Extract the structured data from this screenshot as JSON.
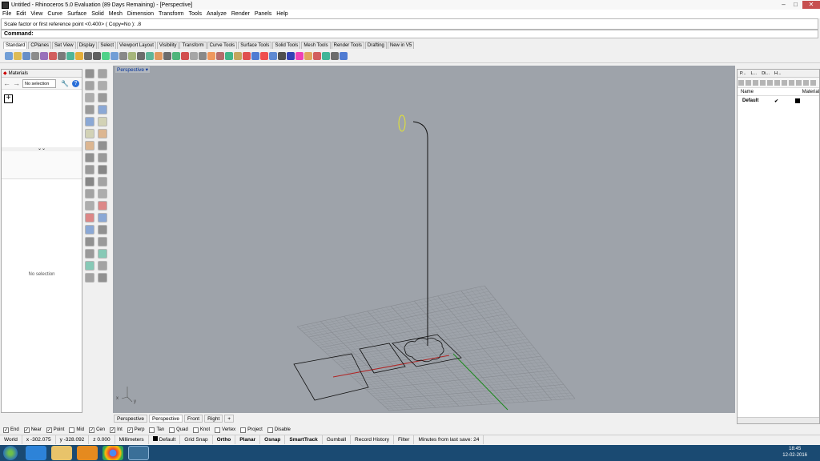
{
  "window": {
    "title": "Untitled - Rhinoceros 5.0 Evaluation (89 Days Remaining) - [Perspective]"
  },
  "menu": [
    "File",
    "Edit",
    "View",
    "Curve",
    "Surface",
    "Solid",
    "Mesh",
    "Dimension",
    "Transform",
    "Tools",
    "Analyze",
    "Render",
    "Panels",
    "Help"
  ],
  "command": {
    "history": "Scale factor or first reference point <0.400> ( Copy=No ): .8",
    "prompt": "Command:"
  },
  "toolbar_tabs": [
    "Standard",
    "CPlanes",
    "Set View",
    "Display",
    "Select",
    "Viewport Layout",
    "Visibility",
    "Transform",
    "Curve Tools",
    "Surface Tools",
    "Solid Tools",
    "Mesh Tools",
    "Render Tools",
    "Drafting",
    "New in V5"
  ],
  "materials_panel": {
    "title": "Materials",
    "selector": "No selection",
    "add": "+",
    "status": "No selection"
  },
  "viewport": {
    "label": "Perspective",
    "dropdown": "▾"
  },
  "layers_panel": {
    "tabs": [
      "P...",
      "L...",
      "Di...",
      "H..."
    ],
    "col_name": "Name",
    "col_material": "Material",
    "layer_name": "Default",
    "check": "✔"
  },
  "viewport_tabs": [
    "Perspective",
    "Perspective",
    "Front",
    "Right",
    "+"
  ],
  "osnaps": [
    {
      "label": "End",
      "checked": true
    },
    {
      "label": "Near",
      "checked": true
    },
    {
      "label": "Point",
      "checked": true
    },
    {
      "label": "Mid",
      "checked": false
    },
    {
      "label": "Cen",
      "checked": true
    },
    {
      "label": "Int",
      "checked": true
    },
    {
      "label": "Perp",
      "checked": true
    },
    {
      "label": "Tan",
      "checked": false
    },
    {
      "label": "Quad",
      "checked": false
    },
    {
      "label": "Knot",
      "checked": false
    },
    {
      "label": "Vertex",
      "checked": false
    },
    {
      "label": "Project",
      "checked": false
    },
    {
      "label": "Disable",
      "checked": false
    }
  ],
  "status": {
    "cplane": "World",
    "x": "x -302.075",
    "y": "y -328.092",
    "z": "z 0.000",
    "units": "Millimeters",
    "layer": "Default",
    "buttons": [
      "Grid Snap",
      "Ortho",
      "Planar",
      "Osnap",
      "SmartTrack",
      "Gumball",
      "Record History",
      "Filter"
    ],
    "save": "Minutes from last save: 24"
  },
  "clock": {
    "time": "18:45",
    "date": "12-02-2016"
  },
  "colors": {
    "viewport_bg": "#9ea3aa",
    "grid": "#878b91",
    "xaxis": "#b02525",
    "yaxis": "#1b8a1b",
    "selected_curve": "#e7e72b"
  }
}
